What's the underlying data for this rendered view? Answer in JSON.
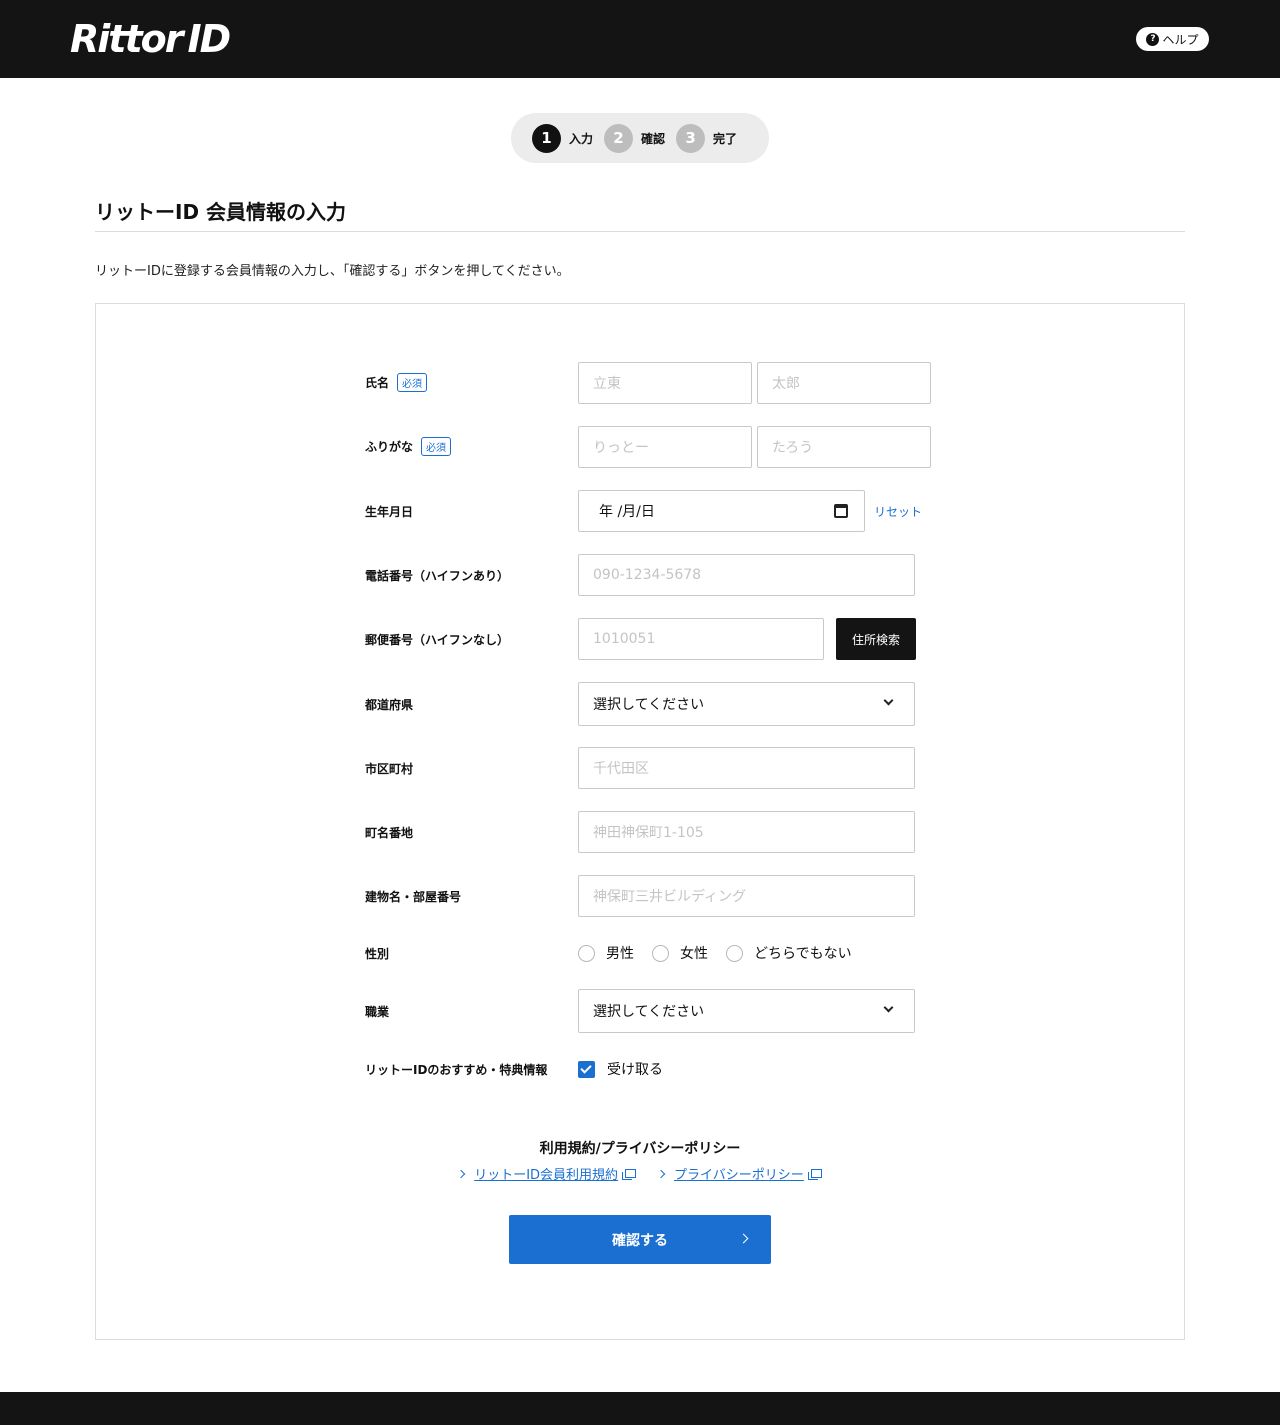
{
  "header": {
    "logo_text": "Rittor",
    "logo_id": "ID",
    "help_label": "ヘルプ",
    "help_icon": "?"
  },
  "steps": [
    {
      "num": "1",
      "label": "入力",
      "active": true
    },
    {
      "num": "2",
      "label": "確認",
      "active": false
    },
    {
      "num": "3",
      "label": "完了",
      "active": false
    }
  ],
  "page": {
    "title": "リットーID 会員情報の入力",
    "lead": "リットーIDに登録する会員情報の入力し、「確認する」ボタンを押してください。"
  },
  "form": {
    "required_badge": "必須",
    "name": {
      "label": "氏名",
      "last_placeholder": "立東",
      "first_placeholder": "太郎"
    },
    "kana": {
      "label": "ふりがな",
      "last_placeholder": "りっとー",
      "first_placeholder": "たろう"
    },
    "birthday": {
      "label": "生年月日",
      "value": "年 /月/日",
      "reset_label": "リセット"
    },
    "phone": {
      "label": "電話番号（ハイフンあり）",
      "placeholder": "090-1234-5678"
    },
    "postal": {
      "label": "郵便番号（ハイフンなし）",
      "placeholder": "1010051",
      "search_label": "住所検索"
    },
    "prefecture": {
      "label": "都道府県",
      "selected": "選択してください"
    },
    "city": {
      "label": "市区町村",
      "placeholder": "千代田区"
    },
    "street": {
      "label": "町名番地",
      "placeholder": "神田神保町1-105"
    },
    "building": {
      "label": "建物名・部屋番号",
      "placeholder": "神保町三井ビルディング"
    },
    "gender": {
      "label": "性別",
      "options": [
        "男性",
        "女性",
        "どちらでもない"
      ]
    },
    "occupation": {
      "label": "職業",
      "selected": "選択してください"
    },
    "newsletter": {
      "label": "リットーIDのおすすめ・特典情報",
      "checkbox_label": "受け取る",
      "checked": true
    }
  },
  "terms": {
    "title": "利用規約/プライバシーポリシー",
    "links": [
      "リットーID会員利用規約",
      "プライバシーポリシー"
    ]
  },
  "submit_label": "確認する",
  "colors": {
    "accent": "#1a6fd0",
    "header_bg": "#141414"
  }
}
